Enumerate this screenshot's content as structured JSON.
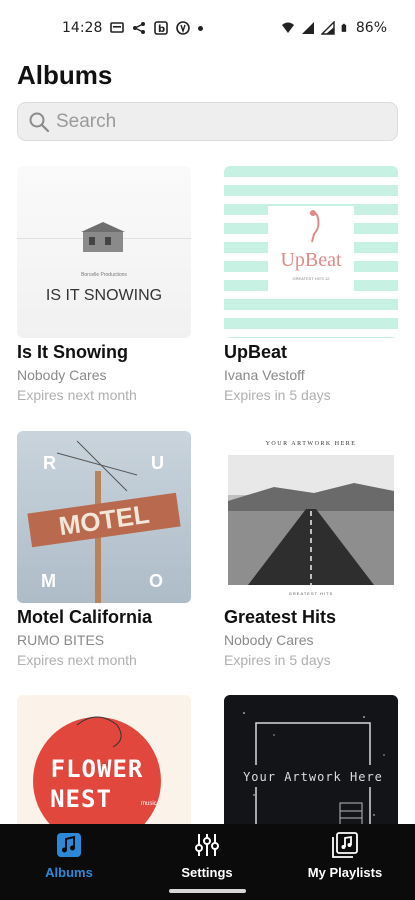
{
  "status_bar": {
    "time": "14:28",
    "battery": "86%"
  },
  "header": {
    "title": "Albums"
  },
  "search": {
    "placeholder": "Search"
  },
  "albums": [
    {
      "title": "Is It Snowing",
      "artist": "Nobody Cares",
      "expiry": "Expires next month",
      "cover_text": "IS IT SNOWING",
      "cover_small": "Borcelle Productions"
    },
    {
      "title": "UpBeat",
      "artist": "Ivana Vestoff",
      "expiry": "Expires in 5 days",
      "cover_text": "UpBeat",
      "cover_small": "GREATEST HITS 12"
    },
    {
      "title": "Motel California",
      "artist": "RUMO BITES",
      "expiry": "Expires next month",
      "cover_text": "MOTEL",
      "cover_letters": [
        "R",
        "U",
        "M",
        "O"
      ]
    },
    {
      "title": "Greatest Hits",
      "artist": "Nobody Cares",
      "expiry": "Expires in 5 days",
      "cover_text": "YOUR ARTWORK HERE",
      "cover_small": "GREATEST HITS"
    },
    {
      "title": "",
      "artist": "",
      "expiry": "",
      "cover_text": "FLOWER",
      "cover_text2": "NEST",
      "cover_small": "music"
    },
    {
      "title": "",
      "artist": "",
      "expiry": "",
      "cover_text": "Your Artwork Here"
    }
  ],
  "bottom_nav": {
    "items": [
      {
        "label": "Albums",
        "icon": "music-note-icon",
        "active": true
      },
      {
        "label": "Settings",
        "icon": "sliders-icon",
        "active": false
      },
      {
        "label": "My Playlists",
        "icon": "playlist-icon",
        "active": false
      }
    ]
  },
  "colors": {
    "accent": "#2e88d8",
    "nav_bg": "#0b0b0b",
    "upbeat_text": "#e08a8a",
    "flower_red": "#e2473d"
  }
}
